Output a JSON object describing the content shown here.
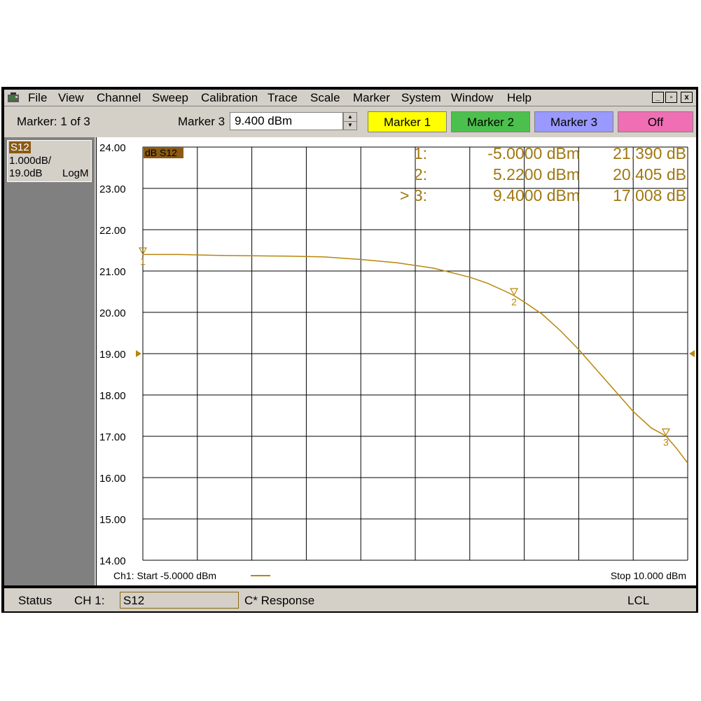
{
  "menubar": {
    "items": [
      "File",
      "View",
      "Channel",
      "Sweep",
      "Calibration",
      "Trace",
      "Scale",
      "Marker",
      "System",
      "Window",
      "Help"
    ],
    "window_buttons": [
      "_",
      "▫",
      "x"
    ]
  },
  "toolbar": {
    "marker_count": "Marker: 1 of 3",
    "marker_label": "Marker 3",
    "marker_value": "9.400 dBm",
    "buttons": [
      {
        "label": "Marker 1",
        "color": "#ffff00"
      },
      {
        "label": "Marker 2",
        "color": "#4cc04c"
      },
      {
        "label": "Marker 3",
        "color": "#9999ff"
      },
      {
        "label": "Off",
        "color": "#f06eb4"
      }
    ]
  },
  "trace_panel": {
    "name": "S12",
    "scale": "1.000dB/",
    "ref": "19.0dB",
    "format": "LogM"
  },
  "plot": {
    "trace_label": "dB S12",
    "start_text": "Ch1: Start  -5.0000 dBm",
    "stop_text": "Stop  10.000 dBm",
    "trace_color": "#b8860b"
  },
  "marker_readout": [
    {
      "id": "1:",
      "x": "-5.0000 dBm",
      "y": "21.390 dB"
    },
    {
      "id": "2:",
      "x": "5.2200 dBm",
      "y": "20.405 dB"
    },
    {
      "id": "> 3:",
      "x": "9.4000 dBm",
      "y": "17.008 dB"
    }
  ],
  "chart_data": {
    "type": "line",
    "xlabel": "",
    "ylabel": "",
    "xlim": [
      -5.0,
      10.0
    ],
    "ylim": [
      14.0,
      24.0
    ],
    "y_ticks": [
      "24.00",
      "23.00",
      "22.00",
      "21.00",
      "20.00",
      "19.00",
      "18.00",
      "17.00",
      "16.00",
      "15.00",
      "14.00"
    ],
    "reference_level": 19.0,
    "grid": true,
    "series": [
      {
        "x": [
          -5.0,
          -4.0,
          -3.0,
          -2.0,
          -1.0,
          0.0,
          1.0,
          2.0,
          3.0,
          4.0,
          4.5,
          5.0,
          5.22,
          5.5,
          6.0,
          6.5,
          7.0,
          7.5,
          8.0,
          8.5,
          9.0,
          9.4,
          9.7,
          10.0
        ],
        "y": [
          21.4,
          21.4,
          21.38,
          21.37,
          21.36,
          21.34,
          21.28,
          21.2,
          21.07,
          20.85,
          20.7,
          20.5,
          20.405,
          20.25,
          19.95,
          19.55,
          19.1,
          18.6,
          18.1,
          17.6,
          17.2,
          17.008,
          16.7,
          16.35
        ]
      }
    ],
    "markers": [
      {
        "label": "1",
        "x": -5.0,
        "y": 21.39
      },
      {
        "label": "2",
        "x": 5.22,
        "y": 20.405
      },
      {
        "label": "3",
        "x": 9.4,
        "y": 17.008
      }
    ]
  },
  "statusbar": {
    "status": "Status",
    "channel": "CH 1:",
    "param": "S12",
    "response": "C* Response",
    "lcl": "LCL"
  }
}
